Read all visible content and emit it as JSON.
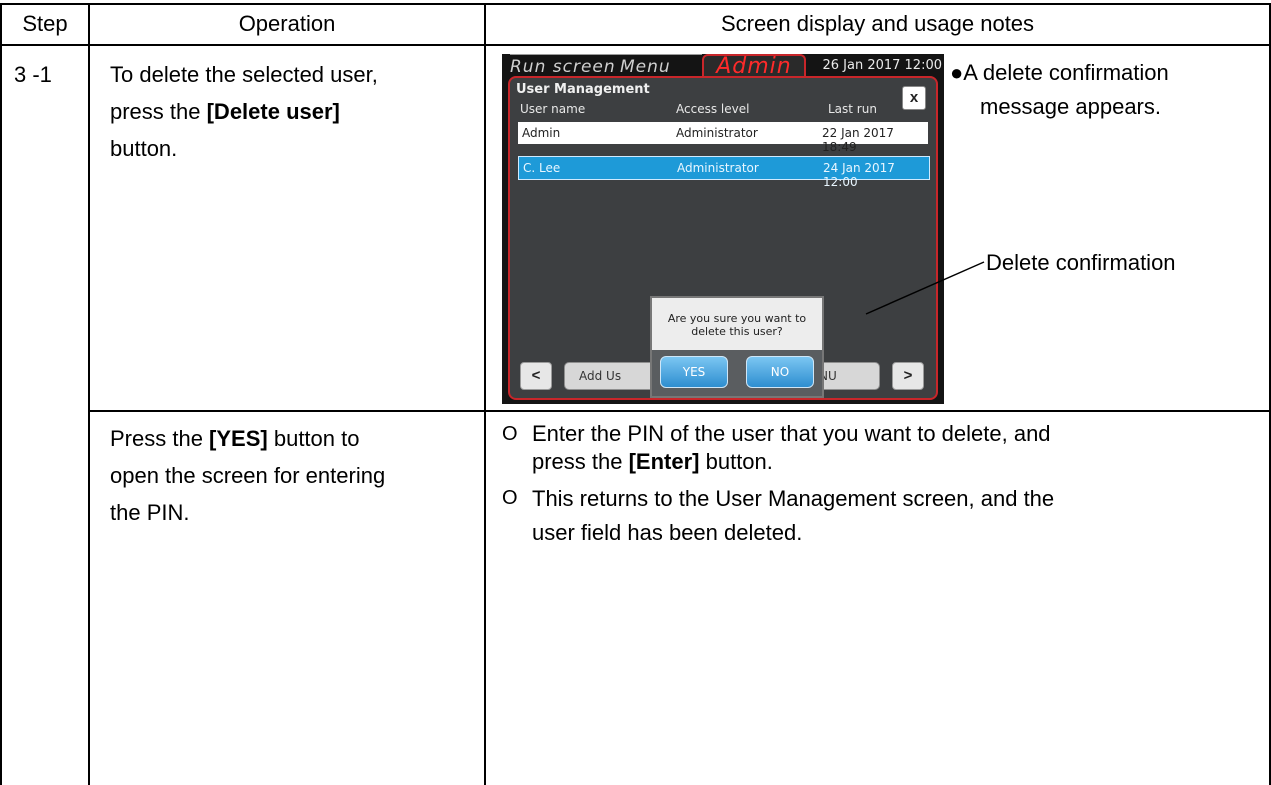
{
  "header": {
    "step": "Step",
    "operation": "Operation",
    "notes": "Screen display and usage notes"
  },
  "row1": {
    "step": "3 -1",
    "op_line1": "To delete the selected user,",
    "op_line2_pre": "press the ",
    "op_line2_bold": "[Delete user]",
    "op_line3": "button.",
    "note_bullet": "●",
    "note_line1": "A delete confirmation",
    "note_line2": "message appears.",
    "callout": "Delete confirmation"
  },
  "device": {
    "tabs": [
      "Run screen",
      "Menu",
      "Admin"
    ],
    "clock": "26  Jan  2017  12:00",
    "title": "User Management",
    "close": "x",
    "columns": [
      "User name",
      "Access level",
      "Last run"
    ],
    "rows": [
      {
        "name": "Admin",
        "level": "Administrator",
        "last_run": "22 Jan 2017 18:49"
      },
      {
        "name": "C. Lee",
        "level": "Administrator",
        "last_run": "24 Jan 2017 12:00"
      }
    ],
    "nav_prev": "<",
    "nav_next": ">",
    "add_button": "Add Us",
    "menu_button": "NU",
    "dialog": {
      "message_line1": "Are you sure you want to",
      "message_line2": "delete this user?",
      "yes": "YES",
      "no": "NO"
    }
  },
  "row2": {
    "op_line1_pre": "Press the ",
    "op_line1_bold": "[YES]",
    "op_line1_post": " button to",
    "op_line2": "open the screen for entering",
    "op_line3": "the PIN.",
    "bullet": "O",
    "note1_line1": "Enter the PIN of the user that you want to delete, and",
    "note1_line2_pre": "press the ",
    "note1_line2_bold": "[Enter]",
    "note1_line2_post": " button.",
    "note2_line1": "This returns to the User Management screen, and the",
    "note2_line2": "user field has been deleted."
  }
}
